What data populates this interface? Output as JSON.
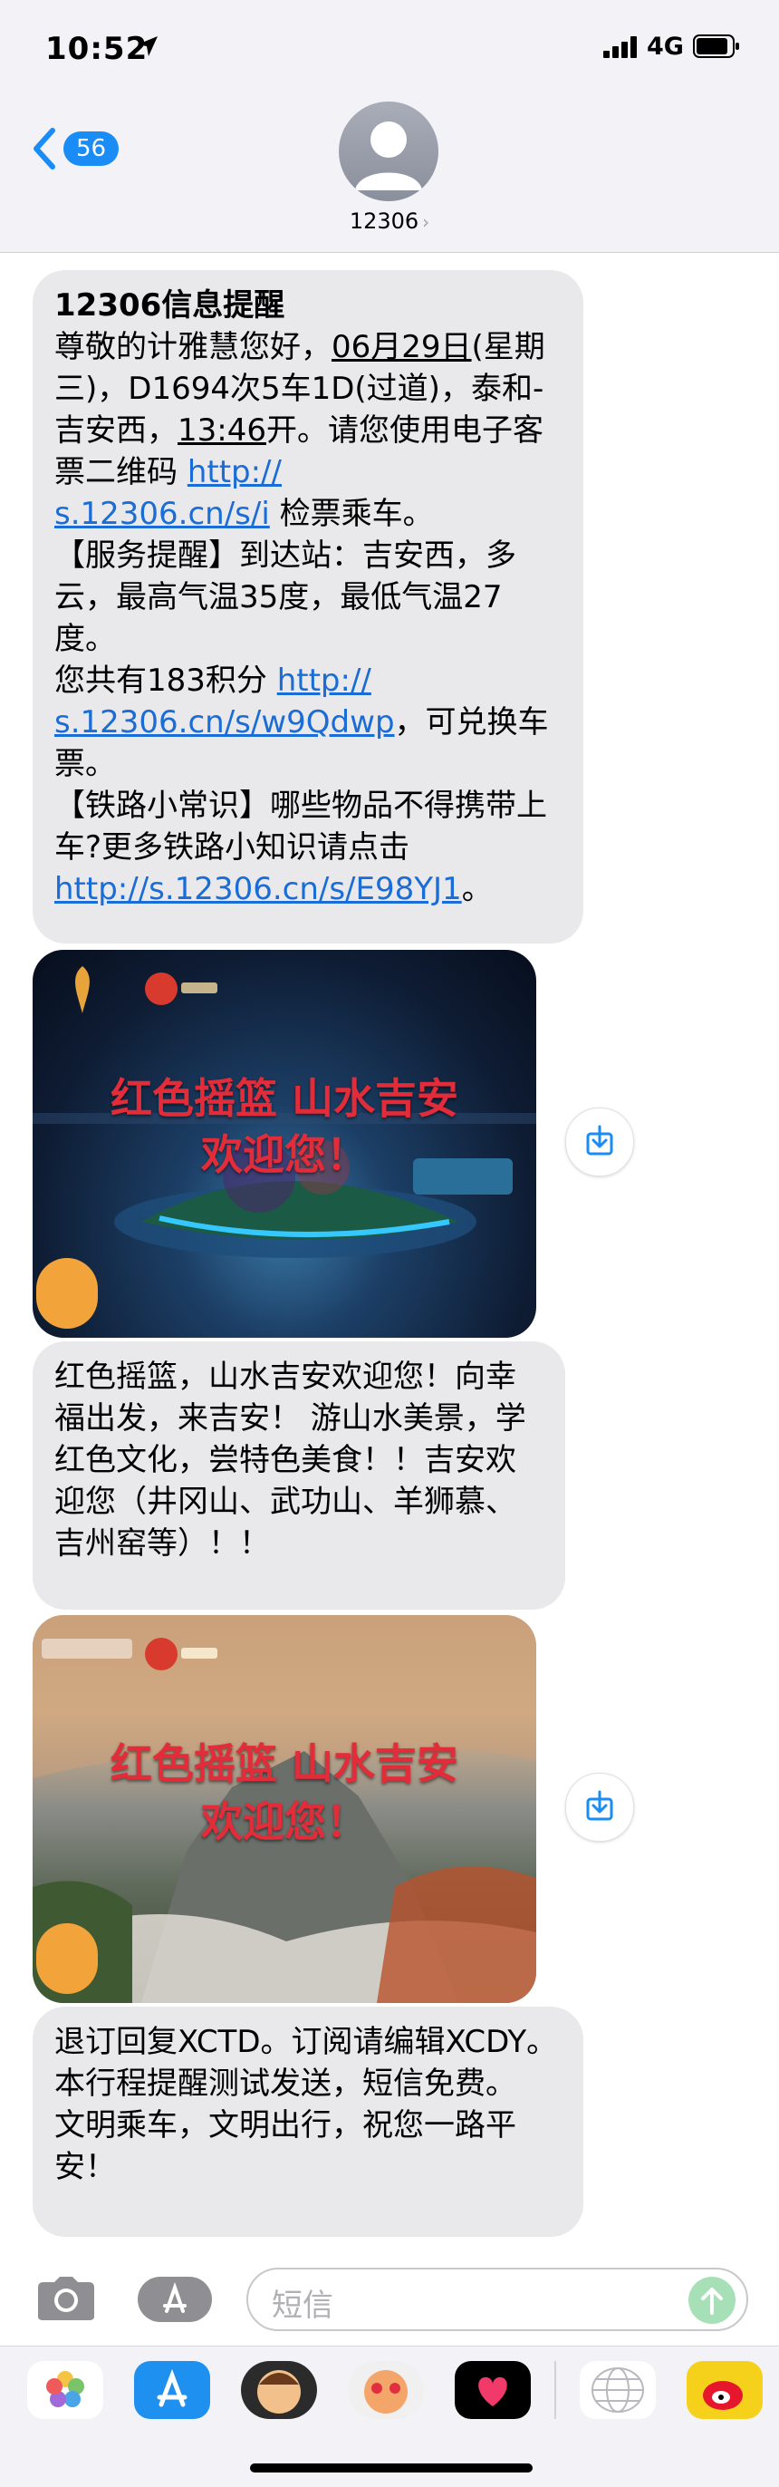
{
  "status_bar": {
    "time": "10:52",
    "network": "4G"
  },
  "header": {
    "back_count": "56",
    "contact": "12306",
    "contact_chevron": "›"
  },
  "messages": {
    "m1": {
      "title": "12306信息提醒",
      "p1": "尊敬的计雅慧您好，",
      "date": "06月29日",
      "p2": "(星期三)，D1694次5车1D(过道)，泰和-吉安西，",
      "time": "13:46",
      "p3": "开。请您使用电子客票二维码",
      "link1_a": "http://",
      "link1_b": "s.12306.cn/s/i",
      "p4": "检票乘车。",
      "p5": "【服务提醒】到达站：吉安西，多云，最高气温35度，最低气温27度。",
      "p6": "您共有183积分",
      "link2_a": "http://",
      "link2_b": "s.12306.cn/s/w9Qdwp",
      "p7": "，可兑换车票。",
      "p8": "【铁路小常识】哪些物品不得携带上车?更多铁路小知识请点击",
      "link3": "http://s.12306.cn/s/E98YJ1",
      "p9": "。"
    },
    "image1": {
      "line1": "红色摇篮  山水吉安",
      "line2": "欢迎您！"
    },
    "m2": {
      "text": "红色摇篮，山水吉安欢迎您！向幸福出发，来吉安！ 游山水美景，学红色文化，尝特色美食！！吉安欢迎您（井冈山、武功山、羊狮慕、吉州窑等）！！"
    },
    "image2": {
      "line1": "红色摇篮  山水吉安",
      "line2": "欢迎您！"
    },
    "m3": {
      "text": "退订回复XCTD。订阅请编辑XCDY。本行程提醒测试发送，短信免费。",
      "text2": "文明乘车，文明出行，祝您一路平安！"
    }
  },
  "input": {
    "placeholder": "短信"
  },
  "icons": {
    "back": "chevron-left-icon",
    "save": "download-icon",
    "camera": "camera-icon",
    "apps": "app-store-icon",
    "send": "arrow-up-icon"
  },
  "colors": {
    "accent": "#1a8cf5",
    "bubble": "#e9e9eb",
    "link": "#1a6dd6",
    "overlay_text": "#e32c3a"
  }
}
